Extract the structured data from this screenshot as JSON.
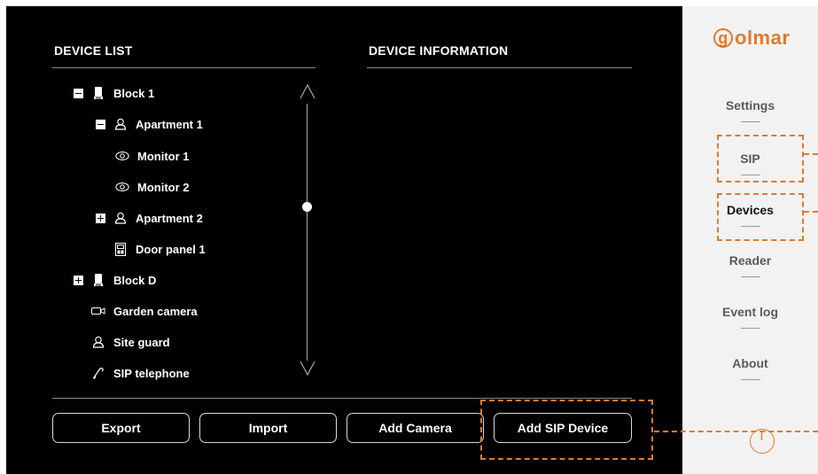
{
  "device_list_title": "DEVICE LIST",
  "device_info_title": "DEVICE INFORMATION",
  "tree": [
    {
      "label": "Block 1",
      "toggle": "minus",
      "icon": "building-icon"
    },
    {
      "label": "Apartment 1",
      "toggle": "minus",
      "icon": "person-icon"
    },
    {
      "label": "Monitor 1",
      "icon": "monitor-eye-icon"
    },
    {
      "label": "Monitor 2",
      "icon": "monitor-eye-icon"
    },
    {
      "label": "Apartment 2",
      "toggle": "plus",
      "icon": "person-icon"
    },
    {
      "label": "Door panel 1",
      "icon": "door-panel-icon"
    },
    {
      "label": "Block D",
      "toggle": "plus",
      "icon": "building-icon"
    },
    {
      "label": "Garden camera",
      "icon": "camera-icon"
    },
    {
      "label": "Site guard",
      "icon": "person-icon"
    },
    {
      "label": "SIP telephone",
      "icon": "telephone-icon"
    }
  ],
  "buttons": {
    "export": "Export",
    "import": "Import",
    "add_camera": "Add Camera",
    "add_sip_device": "Add SIP Device"
  },
  "logo": {
    "g": "g",
    "text": "olmar"
  },
  "menu": {
    "settings": "Settings",
    "sip": "SIP",
    "devices": "Devices",
    "reader": "Reader",
    "event_log": "Event log",
    "about": "About"
  },
  "colors": {
    "accent": "#e07a2e",
    "background": "#000000",
    "sidebar": "#f2f2f2"
  }
}
